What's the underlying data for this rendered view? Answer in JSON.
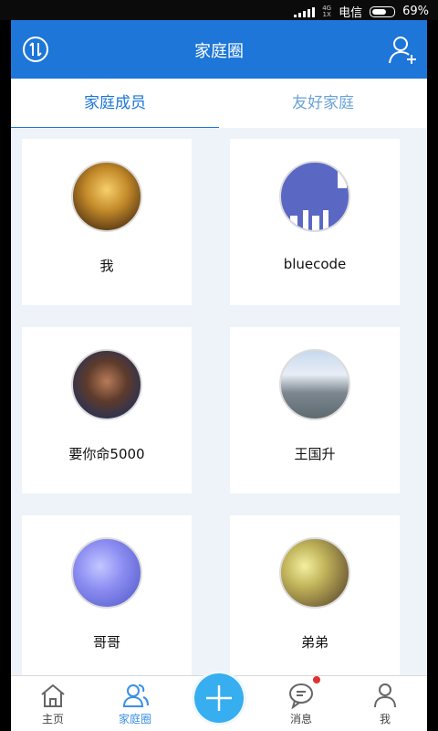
{
  "status_bar": {
    "network": "4G\n1X",
    "carrier": "电信",
    "battery": "69%"
  },
  "header": {
    "title": "家庭圈"
  },
  "tabs": {
    "family_members": "家庭成员",
    "friend_families": "友好家庭"
  },
  "members": [
    {
      "name": "我",
      "avatar": "game-avatar"
    },
    {
      "name": "bluecode",
      "avatar": "blue-text-avatar"
    },
    {
      "name": "要你命5000",
      "avatar": "portrait-avatar"
    },
    {
      "name": "王国升",
      "avatar": "landscape-avatar"
    },
    {
      "name": "哥哥",
      "avatar": "flower-avatar"
    },
    {
      "name": "弟弟",
      "avatar": "squirrel-avatar"
    }
  ],
  "bottom_nav": {
    "home": "主页",
    "family": "家庭圈",
    "messages": "消息",
    "me": "我"
  },
  "colors": {
    "primary": "#1d76d8",
    "fab": "#36aef0",
    "badge": "#e0332e"
  }
}
